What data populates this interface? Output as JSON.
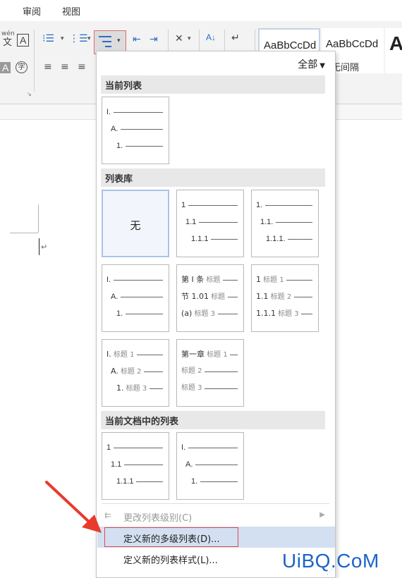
{
  "tabs": [
    "审阅",
    "视图"
  ],
  "ribbon": {
    "phonetic_glyph": "wén",
    "phonetic_char": "文",
    "char_border": "A",
    "char_shading": "A",
    "enclose_char": "字",
    "sort_glyph": "A↓",
    "style_samples": [
      "AaBbCcDd",
      "AaBbCcDd",
      "A"
    ],
    "style_names": [
      "",
      "无间隔"
    ],
    "accent": "#2a6cc9"
  },
  "dropdown": {
    "filter_label": "全部",
    "sections": [
      "当前列表",
      "列表库",
      "当前文档中的列表"
    ],
    "current_list": [
      [
        "I.",
        ""
      ],
      [
        "A.",
        ""
      ],
      [
        "1.",
        ""
      ]
    ],
    "library": {
      "none_label": "无",
      "tiles": [
        [
          [
            "1",
            ""
          ],
          [
            "1.1",
            ""
          ],
          [
            "1.1.1",
            ""
          ]
        ],
        [
          [
            "1.",
            ""
          ],
          [
            "1.1.",
            ""
          ],
          [
            "1.1.1.",
            ""
          ]
        ],
        [
          [
            "I.",
            ""
          ],
          [
            "A.",
            ""
          ],
          [
            "1.",
            ""
          ]
        ],
        [
          [
            "第 Ⅰ 条",
            "标题"
          ],
          [
            "节 1.01",
            "标题"
          ],
          [
            "(a)",
            "标题 3"
          ]
        ],
        [
          [
            "1",
            "标题 1"
          ],
          [
            "1.1",
            "标题 2"
          ],
          [
            "1.1.1",
            "标题 3"
          ]
        ],
        [
          [
            "I.",
            "标题 1"
          ],
          [
            "A.",
            "标题 2"
          ],
          [
            "1.",
            "标题 3"
          ]
        ],
        [
          [
            "第一章",
            "标题 1"
          ],
          [
            "",
            "标题 2"
          ],
          [
            "",
            "标题 3"
          ]
        ]
      ]
    },
    "doc_lists": [
      [
        [
          "1",
          ""
        ],
        [
          "1.1",
          ""
        ],
        [
          "1.1.1",
          ""
        ]
      ],
      [
        [
          "I.",
          ""
        ],
        [
          "A.",
          ""
        ],
        [
          "1.",
          ""
        ]
      ]
    ],
    "menu": {
      "change_level": "更改列表级别(C)",
      "define_multilevel": "定义新的多级列表(D)...",
      "define_style": "定义新的列表样式(L)..."
    }
  },
  "watermark": "UiBQ.CoM",
  "colors": {
    "highlight_red": "#e0484a",
    "hover_blue": "#d3e0f1",
    "watermark_blue": "#1d63c8"
  }
}
